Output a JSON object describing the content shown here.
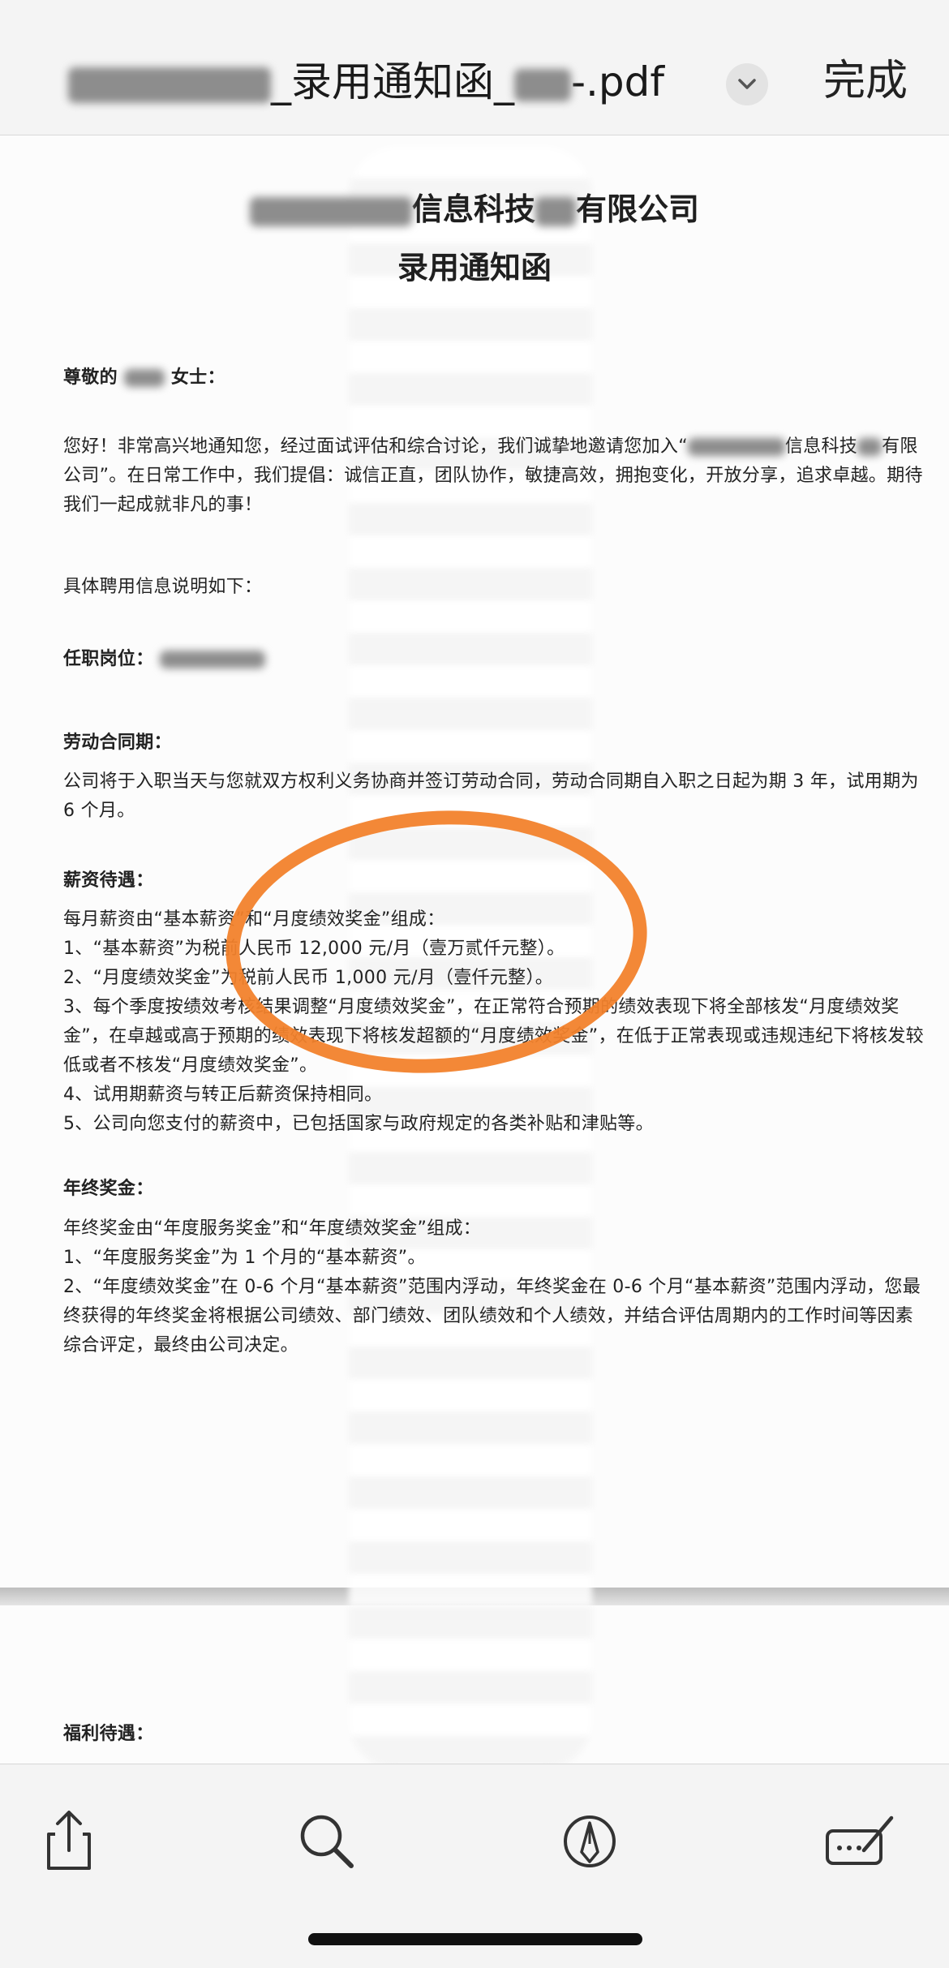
{
  "header": {
    "file_name_middle": "_录用通知函_",
    "file_name_end": "-.pdf",
    "done_label": "完成"
  },
  "document": {
    "company_suffix_1": "信息科技",
    "company_suffix_2": "有限公司",
    "title": "录用通知函",
    "greeting_prefix": "尊敬的",
    "greeting_suffix": "女士：",
    "intro_1": "您好！非常高兴地通知您，经过面试评估和综合讨论，我们诚挚地邀请您加入“",
    "intro_2": "信息科技",
    "intro_3": "有限公司”。在日常工作中，我们提倡：诚信正直，团队协作，敏捷高效，拥抱变化，开放分享，追求卓越。期待我们一起成就非凡的事！",
    "info_intro": "具体聘用信息说明如下：",
    "position_label": "任职岗位：",
    "contract_heading": "劳动合同期：",
    "contract_text": "公司将于入职当天与您就双方权利义务协商并签订劳动合同，劳动合同期自入职之日起为期 3 年，试用期为 6 个月。",
    "salary_heading": "薪资待遇：",
    "salary_lines": [
      "每月薪资由“基本薪资”和“月度绩效奖金”组成：",
      "1、“基本薪资”为税前人民币 12,000 元/月（壹万贰仟元整）。",
      "2、“月度绩效奖金”为税前人民币 1,000 元/月（壹仟元整）。",
      "3、每个季度按绩效考核结果调整“月度绩效奖金”，在正常符合预期的绩效表现下将全部核发“月度绩效奖金”，在卓越或高于预期的绩效表现下将核发超额的“月度绩效奖金”，在低于正常表现或违规违纪下将核发较低或者不核发“月度绩效奖金”。",
      "4、试用期薪资与转正后薪资保持相同。",
      "5、公司向您支付的薪资中，已包括国家与政府规定的各类补贴和津贴等。"
    ],
    "bonus_heading": "年终奖金：",
    "bonus_lines": [
      "年终奖金由“年度服务奖金”和“年度绩效奖金”组成：",
      "1、“年度服务奖金”为 1 个月的“基本薪资”。",
      "2、“年度绩效奖金”在 0-6 个月“基本薪资”范围内浮动，年终奖金在 0-6 个月“基本薪资”范围内浮动，您最终获得的年终奖金将根据公司绩效、部门绩效、团队绩效和个人绩效，并结合评估周期内的工作时间等因素综合评定，最终由公司决定。"
    ],
    "benefits_heading": "福利待遇："
  },
  "colors": {
    "annotation_orange": "#f2822c",
    "toolbar_icon": "#333333"
  },
  "icons": {
    "share": "share-icon",
    "search": "search-icon",
    "markup": "markup-pen-icon",
    "signature": "signature-icon"
  }
}
